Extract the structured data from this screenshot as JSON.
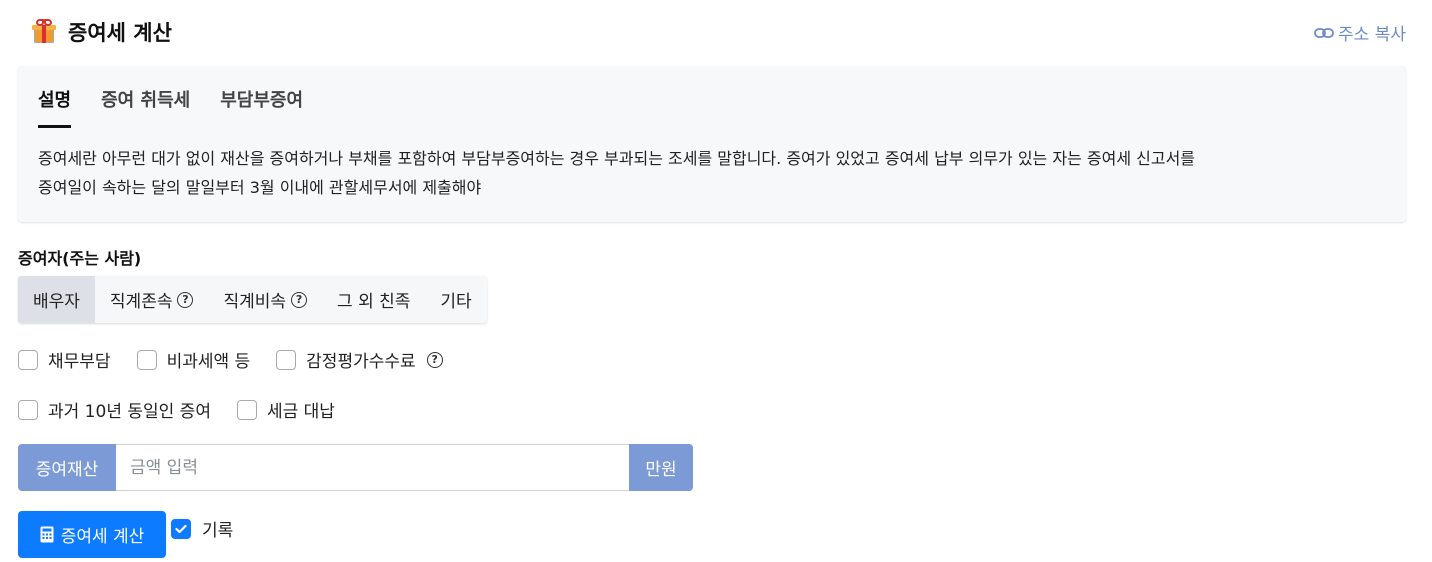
{
  "header": {
    "title": "증여세 계산",
    "icon": "gift-icon"
  },
  "copy_link": {
    "label": "주소 복사",
    "icon": "link-icon",
    "color": "#6b8ac7"
  },
  "info": {
    "tabs": [
      {
        "label": "설명",
        "active": true
      },
      {
        "label": "증여 취득세",
        "active": false
      },
      {
        "label": "부담부증여",
        "active": false
      }
    ],
    "description_line1": "증여세란 아무런 대가 없이 재산을 증여하거나 부채를 포함하여 부담부증여하는 경우 부과되는 조세를 말합니다. 증여가 있었고 증여세 납부 의무가 있는 자는 증여세 신고서를",
    "description_line2": "증여일이 속하는 달의 말일부터 3월 이내에 관할세무서에 제출해야"
  },
  "giver": {
    "label": "증여자(주는 사람)",
    "options": [
      {
        "label": "배우자",
        "active": true,
        "help": false
      },
      {
        "label": "직계존속",
        "active": false,
        "help": true
      },
      {
        "label": "직계비속",
        "active": false,
        "help": true
      },
      {
        "label": "그 외 친족",
        "active": false,
        "help": false
      },
      {
        "label": "기타",
        "active": false,
        "help": false
      }
    ]
  },
  "options_row1": [
    {
      "label": "채무부담",
      "checked": false
    },
    {
      "label": "비과세액 등",
      "checked": false
    },
    {
      "label": "감정평가수수료",
      "checked": false,
      "help": true
    }
  ],
  "options_row2": [
    {
      "label": "과거 10년 동일인 증여",
      "checked": false
    },
    {
      "label": "세금 대납",
      "checked": false
    }
  ],
  "amount": {
    "prefix": "증여재산",
    "placeholder": "금액 입력",
    "value": "",
    "suffix": "만원"
  },
  "calc_button": {
    "label": "증여세 계산",
    "icon": "calculator-icon",
    "color": "#0d7bff"
  },
  "record": {
    "label": "기록",
    "checked": true
  },
  "help_glyph": "?",
  "accent_color": "#7b9ad6"
}
